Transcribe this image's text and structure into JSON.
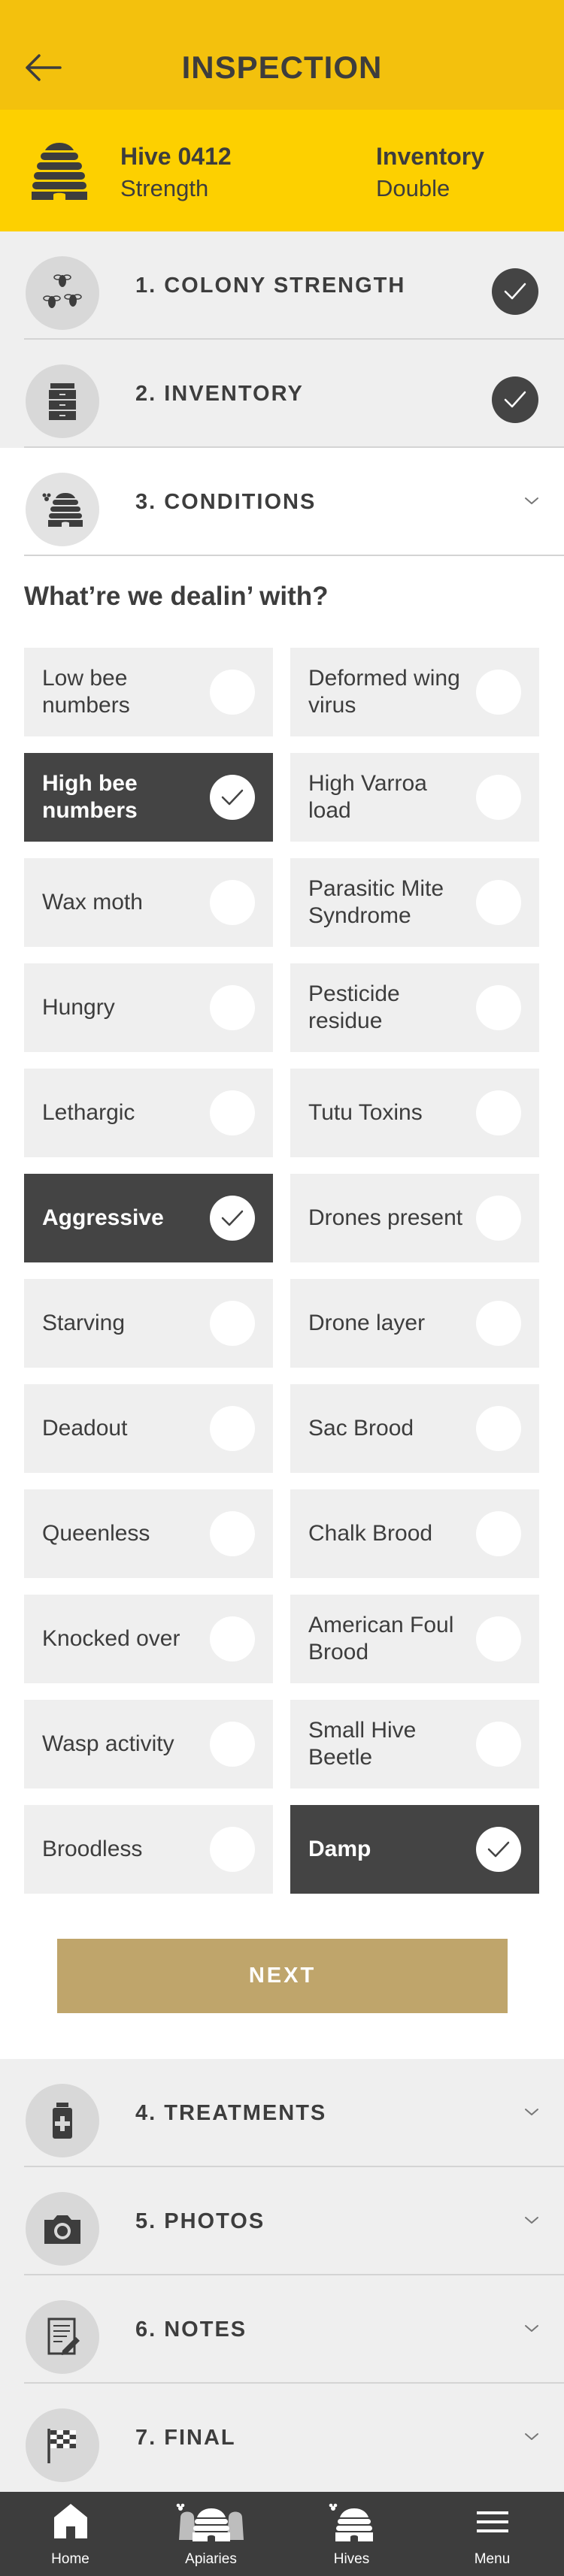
{
  "header": {
    "title": "INSPECTION",
    "back_icon": "arrow-left-icon"
  },
  "hive": {
    "name": "Hive 0412",
    "strength_label": "Strength",
    "inventory_label": "Inventory",
    "inventory_value": "Double",
    "icon": "beehive-icon"
  },
  "sections": [
    {
      "label": "1. COLONY STRENGTH",
      "icon": "bees-icon",
      "status": "complete"
    },
    {
      "label": "2. INVENTORY",
      "icon": "hive-boxes-icon",
      "status": "complete"
    },
    {
      "label": "3. CONDITIONS",
      "icon": "hive-with-bee-icon",
      "status": "expanded"
    },
    {
      "label": "4. TREATMENTS",
      "icon": "medicine-bottle-icon",
      "status": "collapsed"
    },
    {
      "label": "5. PHOTOS",
      "icon": "camera-icon",
      "status": "collapsed"
    },
    {
      "label": "6. NOTES",
      "icon": "notepad-icon",
      "status": "collapsed"
    },
    {
      "label": "7. FINAL",
      "icon": "checkered-flag-icon",
      "status": "collapsed"
    }
  ],
  "conditions": {
    "question": "What’re we dealin’ with?",
    "options": [
      {
        "label": "Low bee numbers",
        "selected": false
      },
      {
        "label": "Deformed wing virus",
        "selected": false
      },
      {
        "label": "High bee numbers",
        "selected": true
      },
      {
        "label": "High Varroa load",
        "selected": false
      },
      {
        "label": "Wax moth",
        "selected": false
      },
      {
        "label": "Parasitic Mite Syndrome",
        "selected": false
      },
      {
        "label": "Hungry",
        "selected": false
      },
      {
        "label": "Pesticide residue",
        "selected": false
      },
      {
        "label": "Lethargic",
        "selected": false
      },
      {
        "label": "Tutu Toxins",
        "selected": false
      },
      {
        "label": "Aggressive",
        "selected": true
      },
      {
        "label": "Drones present",
        "selected": false
      },
      {
        "label": "Starving",
        "selected": false
      },
      {
        "label": "Drone layer",
        "selected": false
      },
      {
        "label": "Deadout",
        "selected": false
      },
      {
        "label": "Sac Brood",
        "selected": false
      },
      {
        "label": "Queenless",
        "selected": false
      },
      {
        "label": "Chalk Brood",
        "selected": false
      },
      {
        "label": "Knocked over",
        "selected": false
      },
      {
        "label": "American Foul Brood",
        "selected": false
      },
      {
        "label": "Wasp activity",
        "selected": false
      },
      {
        "label": "Small Hive Beetle",
        "selected": false
      },
      {
        "label": "Broodless",
        "selected": false
      },
      {
        "label": "Damp",
        "selected": true
      }
    ],
    "next_label": "NEXT"
  },
  "tabbar": {
    "items": [
      {
        "label": "Home",
        "icon": "home-icon"
      },
      {
        "label": "Apiaries",
        "icon": "apiaries-icon"
      },
      {
        "label": "Hives",
        "icon": "hives-icon"
      },
      {
        "label": "Menu",
        "icon": "hamburger-menu-icon"
      }
    ]
  },
  "colors": {
    "header_yellow": "#f3c10d",
    "hive_bar_yellow": "#fdd000",
    "dark": "#444444",
    "next_button": "#bfa56b",
    "tabbar": "#3d3d3d"
  }
}
